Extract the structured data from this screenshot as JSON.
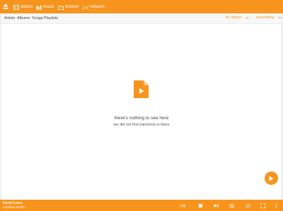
{
  "topnav": {
    "tabs": [
      {
        "label": "videos",
        "icon": "film-icon"
      },
      {
        "label": "music",
        "icon": "music-bars-icon"
      },
      {
        "label": "browse",
        "icon": "folder-icon"
      },
      {
        "label": "network",
        "icon": "wifi-signal-icon"
      }
    ]
  },
  "filterbar": {
    "categories": [
      "Artists",
      "Albums",
      "Songs",
      "Playlists"
    ],
    "sort_by": "by album",
    "sort_order": "ascending"
  },
  "empty_state": {
    "title": "there's nothing to see here",
    "subtitle": "we did not find elements in there"
  },
  "now_playing": {
    "title": "Feral Love",
    "artist": "Chelsea Wolfe"
  },
  "colors": {
    "accent": "#f7941d",
    "background": "#ffffff",
    "frame": "#f0f0f0"
  }
}
